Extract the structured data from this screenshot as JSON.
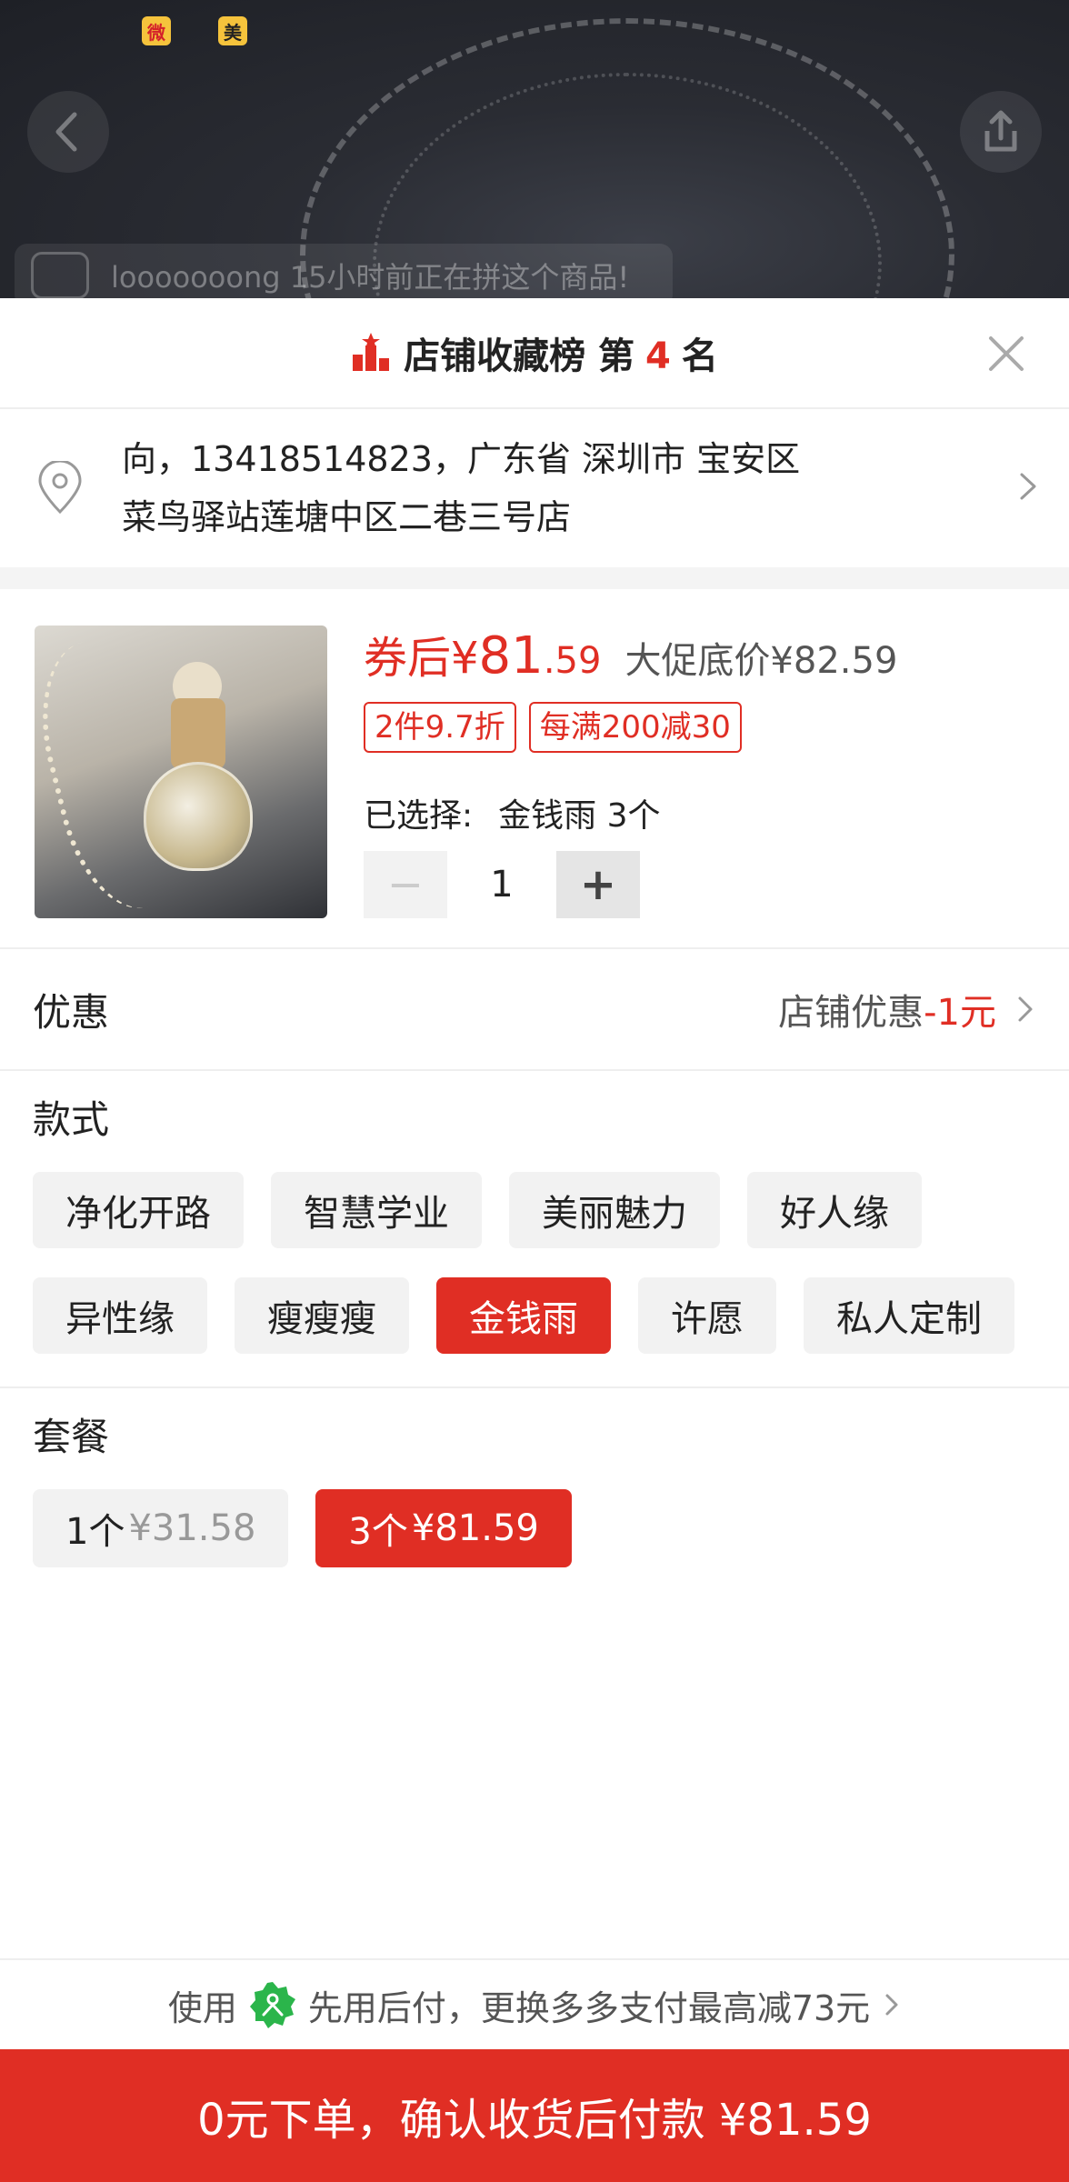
{
  "status_bar": {
    "icons": [
      "weibo-icon",
      "meituan-icon"
    ],
    "weibo_glyph": "微",
    "meituan_glyph": "美"
  },
  "background": {
    "buyer_text": "looooooong 15小时前正在拼这个商品!"
  },
  "rank": {
    "prefix": "店铺收藏榜 第",
    "number": "4",
    "suffix": "名"
  },
  "address": {
    "line1": "向，13418514823，广东省 深圳市 宝安区",
    "line2": "菜鸟驿站莲塘中区二巷三号店"
  },
  "product": {
    "price_prefix": "券后¥",
    "price_int": "81",
    "price_dec": ".59",
    "promo_price": "大促底价¥82.59",
    "tags": [
      "2件9.7折",
      "每满200减30"
    ],
    "selected_label": "已选择:",
    "selected_value": "金钱雨 3个",
    "quantity": "1",
    "minus": "−",
    "plus": "+"
  },
  "discount": {
    "label": "优惠",
    "text": "店铺优惠",
    "amount": "-1元"
  },
  "style": {
    "title": "款式",
    "options": [
      {
        "label": "净化开路",
        "selected": false
      },
      {
        "label": "智慧学业",
        "selected": false
      },
      {
        "label": "美丽魅力",
        "selected": false
      },
      {
        "label": "好人缘",
        "selected": false
      },
      {
        "label": "异性缘",
        "selected": false
      },
      {
        "label": "瘦瘦瘦",
        "selected": false
      },
      {
        "label": "金钱雨",
        "selected": true
      },
      {
        "label": "许愿",
        "selected": false
      },
      {
        "label": "私人定制",
        "selected": false
      }
    ]
  },
  "package": {
    "title": "套餐",
    "options": [
      {
        "label": "1个",
        "price": "¥31.58",
        "selected": false
      },
      {
        "label": "3个",
        "price": "¥81.59",
        "selected": true
      }
    ]
  },
  "pay_hint": {
    "prefix": "使用",
    "text": "先用后付，更换多多支付最高减73元"
  },
  "cta": {
    "label": "0元下单，确认收货后付款 ¥81.59"
  },
  "colors": {
    "accent": "#e02e24",
    "chip_bg": "#f2f2f2",
    "pay_badge": "#2bb54b"
  }
}
